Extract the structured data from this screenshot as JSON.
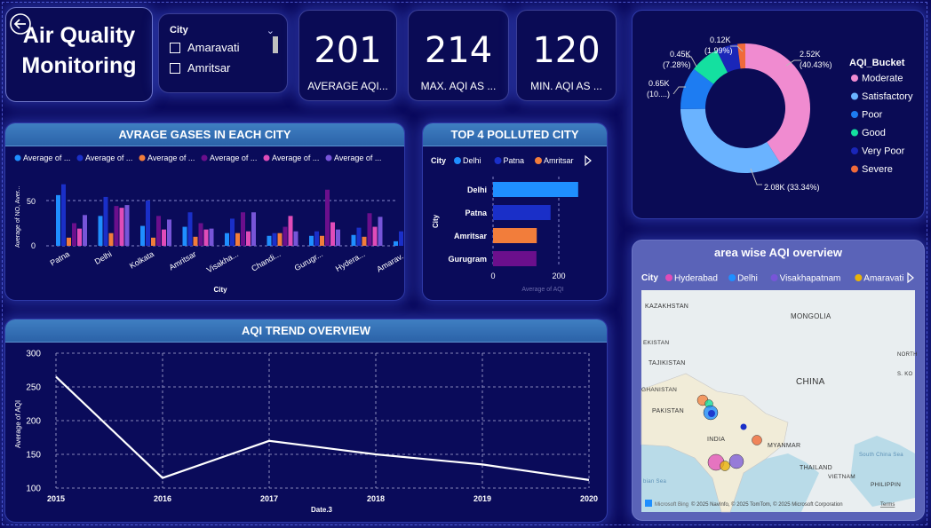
{
  "title": {
    "line1": "Air Quality",
    "line2": "Monitoring"
  },
  "slicer": {
    "title": "City",
    "items": [
      "Amaravati",
      "Amritsar"
    ]
  },
  "kpis": [
    {
      "value": "201",
      "label": "AVERAGE AQI..."
    },
    {
      "value": "214",
      "label": "MAX. AQI AS ..."
    },
    {
      "value": "120",
      "label": "MIN. AQI AS ..."
    }
  ],
  "donut": {
    "legend_title": "AQI_Bucket",
    "slices": [
      {
        "name": "Moderate",
        "value": 2.52,
        "label1": "2.52K",
        "label2": "(40.43%)",
        "color": "#f08bd0"
      },
      {
        "name": "Satisfactory",
        "value": 2.08,
        "label1": "2.08K (33.34%)",
        "label2": "",
        "color": "#6ab3ff"
      },
      {
        "name": "Poor",
        "value": 0.65,
        "label1": "0.65K",
        "label2": "(10....)",
        "color": "#1d7cf2"
      },
      {
        "name": "Good",
        "value": 0.45,
        "label1": "0.45K",
        "label2": "(7.28%)",
        "color": "#14e0a0"
      },
      {
        "name": "Very Poor",
        "value": 0.33,
        "label1": "",
        "label2": "",
        "color": "#1a26b8"
      },
      {
        "name": "Severe",
        "value": 0.12,
        "label1": "0.12K",
        "label2": "(1.99%)",
        "color": "#f06a3a"
      }
    ]
  },
  "gases": {
    "header": "AVRAGE GASES IN EACH CITY",
    "ylabel": "Average of NO, Aver...",
    "xlabel": "City",
    "legend": [
      {
        "label": "Average of ...",
        "color": "#1f8fff"
      },
      {
        "label": "Average of ...",
        "color": "#1a2fc8"
      },
      {
        "label": "Average of ...",
        "color": "#f27d3b"
      },
      {
        "label": "Average of ...",
        "color": "#6b0f8c"
      },
      {
        "label": "Average of ...",
        "color": "#e04cb8"
      },
      {
        "label": "Average of ...",
        "color": "#7755d8"
      }
    ],
    "yticks": [
      "0",
      "50"
    ]
  },
  "chart_data": [
    {
      "type": "bar",
      "title": "AVRAGE GASES IN EACH CITY",
      "xlabel": "City",
      "ylabel": "Average of NO, Aver...",
      "ylim": [
        0,
        75
      ],
      "categories": [
        "Patna",
        "Delhi",
        "Kolkata",
        "Amritsar",
        "Visakha...",
        "Chandi...",
        "Gurugr...",
        "Hydera...",
        "Amarav..."
      ],
      "series": [
        {
          "name": "Average of ...",
          "values": [
            56,
            33,
            22,
            21,
            14,
            11,
            11,
            12,
            5
          ]
        },
        {
          "name": "Average of ...",
          "values": [
            68,
            54,
            50,
            37,
            30,
            14,
            16,
            20,
            16
          ]
        },
        {
          "name": "Average of ...",
          "values": [
            9,
            14,
            9,
            10,
            14,
            14,
            11,
            10,
            16
          ]
        },
        {
          "name": "Average of ...",
          "values": [
            25,
            44,
            33,
            25,
            37,
            21,
            62,
            36,
            40
          ]
        },
        {
          "name": "Average of ...",
          "values": [
            19,
            42,
            18,
            18,
            16,
            33,
            26,
            21,
            13
          ]
        },
        {
          "name": "Average of ...",
          "values": [
            34,
            45,
            29,
            19,
            37,
            16,
            18,
            32,
            24
          ]
        }
      ]
    },
    {
      "type": "bar",
      "title": "TOP 4 POLLUTED CITY",
      "xlabel": "Average of AQI",
      "ylabel": "City",
      "xlim": [
        0,
        260
      ],
      "categories": [
        "Delhi",
        "Patna",
        "Amritsar",
        "Gurugram"
      ],
      "values": [
        259,
        175,
        133,
        132
      ],
      "colors": [
        "#1f8fff",
        "#1a2fc8",
        "#f27d3b",
        "#6b0f8c"
      ]
    },
    {
      "type": "line",
      "title": "AQI TREND OVERVIEW",
      "xlabel": "Date.3",
      "ylabel": "Average of AQI",
      "x": [
        2015,
        2016,
        2017,
        2018,
        2019,
        2020
      ],
      "y": [
        265,
        115,
        170,
        150,
        135,
        112
      ],
      "ylim": [
        100,
        300
      ]
    }
  ],
  "top4": {
    "header": "TOP 4 POLLUTED CITY",
    "legend_title": "City",
    "legend": [
      {
        "label": "Delhi",
        "color": "#1f8fff"
      },
      {
        "label": "Patna",
        "color": "#1a2fc8"
      },
      {
        "label": "Amritsar",
        "color": "#f27d3b"
      }
    ],
    "ylabel": "City",
    "xlabel": "Average of AQI",
    "xticks": [
      "0",
      "200"
    ]
  },
  "trend": {
    "header": "AQI TREND OVERVIEW",
    "ylabel": "Average of AQI",
    "xlabel": "Date.3",
    "yticks": [
      "300",
      "250",
      "200",
      "150",
      "100"
    ],
    "xticks": [
      "2015",
      "2016",
      "2017",
      "2018",
      "2019",
      "2020"
    ]
  },
  "map": {
    "header": "area wise AQI overview",
    "legend_title": "City",
    "legend": [
      {
        "label": "Hyderabad",
        "color": "#e04cb8"
      },
      {
        "label": "Delhi",
        "color": "#1f8fff"
      },
      {
        "label": "Visakhapatnam",
        "color": "#7755d8"
      },
      {
        "label": "Amaravati",
        "color": "#e8b30a"
      }
    ],
    "labels": [
      "KAZAKHSTAN",
      "MONGOLIA",
      "EKISTAN",
      "TAJIKISTAN",
      "GHANISTAN",
      "CHINA",
      "PAKISTAN",
      "INDIA",
      "MYANMAR",
      "THAILAND",
      "VIETNAM",
      "PHILIPPIN",
      "South China Sea",
      "bian Sea",
      "NORTH",
      "S. KO"
    ],
    "attribution": "© 2025 NavInfo, © 2025 TomTom, © 2025 Microsoft Corporation",
    "terms": "Terms",
    "bing": "Microsoft Bing"
  }
}
